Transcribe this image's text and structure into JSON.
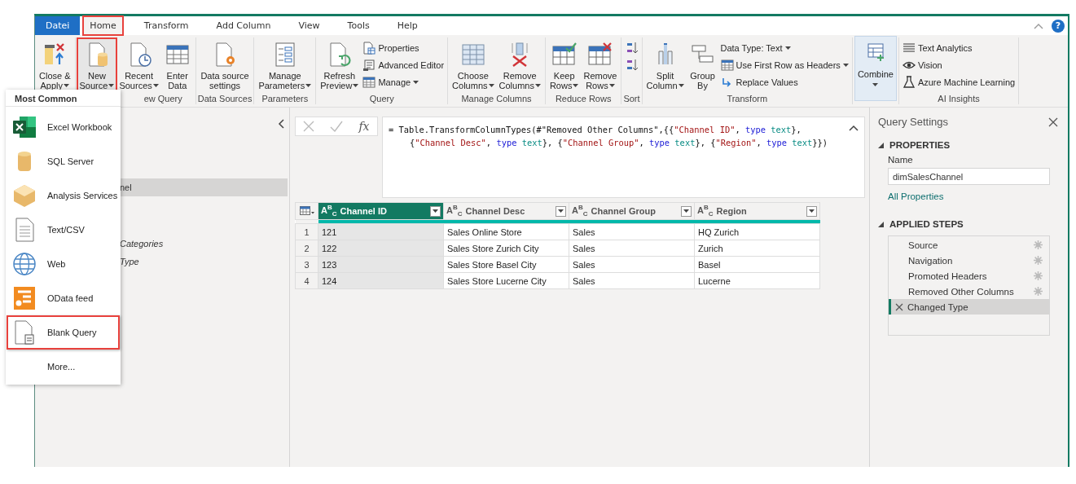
{
  "tabs": [
    {
      "label": "Datei",
      "kind": "file",
      "selected": false,
      "highlighted": false
    },
    {
      "label": "Home",
      "kind": "tab",
      "selected": true,
      "highlighted": true
    },
    {
      "label": "Transform",
      "kind": "tab",
      "selected": false,
      "highlighted": false
    },
    {
      "label": "Add Column",
      "kind": "tab",
      "selected": false,
      "highlighted": false
    },
    {
      "label": "View",
      "kind": "tab",
      "selected": false,
      "highlighted": false
    },
    {
      "label": "Tools",
      "kind": "tab",
      "selected": false,
      "highlighted": false
    },
    {
      "label": "Help",
      "kind": "tab",
      "selected": false,
      "highlighted": false
    }
  ],
  "help_label": "?",
  "ribbon_groups": [
    {
      "items": [
        {
          "kind": "large",
          "lines": [
            "Close &",
            "Apply"
          ],
          "dropdown": true,
          "highlighted": false,
          "pressed": false
        }
      ]
    },
    {
      "label": "ew Query",
      "items": [
        {
          "kind": "large",
          "lines": [
            "New",
            "Source"
          ],
          "dropdown": true,
          "highlighted": true,
          "pressed": false
        },
        {
          "kind": "large",
          "lines": [
            "Recent",
            "Sources"
          ],
          "dropdown": true,
          "highlighted": false,
          "pressed": false
        },
        {
          "kind": "large",
          "lines": [
            "Enter",
            "Data"
          ],
          "dropdown": false,
          "highlighted": false,
          "pressed": false
        }
      ]
    },
    {
      "label": "Data Sources",
      "items": [
        {
          "kind": "large",
          "lines": [
            "Data source",
            "settings"
          ],
          "dropdown": false,
          "highlighted": false,
          "pressed": false
        }
      ]
    },
    {
      "label": "Parameters",
      "items": [
        {
          "kind": "large",
          "lines": [
            "Manage",
            "Parameters"
          ],
          "dropdown": true,
          "highlighted": false,
          "pressed": false
        }
      ]
    },
    {
      "label": "Query",
      "items": [
        {
          "kind": "large",
          "lines": [
            "Refresh",
            "Preview"
          ],
          "dropdown": true,
          "highlighted": false,
          "pressed": false
        },
        {
          "kind": "stack",
          "items": [
            {
              "label": "Properties",
              "dropdown": false
            },
            {
              "label": "Advanced Editor",
              "dropdown": false
            },
            {
              "label": "Manage",
              "dropdown": true
            }
          ]
        }
      ]
    },
    {
      "label": "Manage Columns",
      "items": [
        {
          "kind": "large",
          "lines": [
            "Choose",
            "Columns"
          ],
          "dropdown": true,
          "highlighted": false,
          "pressed": false
        },
        {
          "kind": "large",
          "lines": [
            "Remove",
            "Columns"
          ],
          "dropdown": true,
          "highlighted": false,
          "pressed": false
        }
      ]
    },
    {
      "label": "Reduce Rows",
      "items": [
        {
          "kind": "large",
          "lines": [
            "Keep",
            "Rows"
          ],
          "dropdown": true,
          "highlighted": false,
          "pressed": false
        },
        {
          "kind": "large",
          "lines": [
            "Remove",
            "Rows"
          ],
          "dropdown": true,
          "highlighted": false,
          "pressed": false
        }
      ]
    },
    {
      "label": "Sort",
      "items": [
        {
          "kind": "stack",
          "items": [
            {
              "dropdown": false
            },
            {
              "dropdown": false
            }
          ]
        }
      ]
    },
    {
      "label": "Transform",
      "items": [
        {
          "kind": "large",
          "lines": [
            "Split",
            "Column"
          ],
          "dropdown": true,
          "highlighted": false,
          "pressed": false
        },
        {
          "kind": "large",
          "lines": [
            "Group",
            "By"
          ],
          "dropdown": false,
          "highlighted": false,
          "pressed": false
        },
        {
          "kind": "stack",
          "items": [
            {
              "label": "Data Type: Text",
              "dropdown": true
            },
            {
              "label": "Use First Row as Headers",
              "dropdown": true
            },
            {
              "label": "Replace Values",
              "dropdown": false
            }
          ]
        }
      ]
    },
    {
      "items": [
        {
          "kind": "large",
          "lines": [
            "Combine"
          ],
          "dropdown": true,
          "highlighted": false,
          "pressed": true
        }
      ]
    },
    {
      "label": "AI Insights",
      "items": [
        {
          "kind": "stack",
          "items": [
            {
              "label": "Text Analytics",
              "dropdown": false
            },
            {
              "label": "Vision",
              "dropdown": false
            },
            {
              "label": "Azure Machine Learning",
              "dropdown": false
            }
          ]
        }
      ]
    }
  ],
  "queries_pane": {
    "items": [
      {
        "label": "nel",
        "selected": true,
        "italic": false
      },
      {
        "label": "Categories",
        "selected": false,
        "italic": true
      },
      {
        "label": "Type",
        "selected": false,
        "italic": true
      }
    ]
  },
  "formula_bar": {
    "fx_label": "fx",
    "lines": [
      [
        {
          "text": "= Table.TransformColumnTypes(#\"Removed Other Columns\",{{",
          "kind": "plain"
        },
        {
          "text": "\"Channel ID\"",
          "kind": "string"
        },
        {
          "text": ", ",
          "kind": "plain"
        },
        {
          "text": "type",
          "kind": "keyword"
        },
        {
          "text": " text",
          "kind": "type"
        },
        {
          "text": "},",
          "kind": "plain"
        }
      ],
      [
        {
          "text": "{",
          "kind": "plain"
        },
        {
          "text": "\"Channel Desc\"",
          "kind": "string"
        },
        {
          "text": ", ",
          "kind": "plain"
        },
        {
          "text": "type",
          "kind": "keyword"
        },
        {
          "text": " text",
          "kind": "type"
        },
        {
          "text": "}, {",
          "kind": "plain"
        },
        {
          "text": "\"Channel Group\"",
          "kind": "string"
        },
        {
          "text": ", ",
          "kind": "plain"
        },
        {
          "text": "type",
          "kind": "keyword"
        },
        {
          "text": " text",
          "kind": "type"
        },
        {
          "text": "}, {",
          "kind": "plain"
        },
        {
          "text": "\"Region\"",
          "kind": "string"
        },
        {
          "text": ", ",
          "kind": "plain"
        },
        {
          "text": "type",
          "kind": "keyword"
        },
        {
          "text": " text",
          "kind": "type"
        },
        {
          "text": "}})",
          "kind": "plain"
        }
      ]
    ]
  },
  "table": {
    "columns": [
      {
        "name": "Channel ID",
        "type": "A$^{B}$$_{C}$",
        "selected": true
      },
      {
        "name": "Channel Desc",
        "type": "A$^{B}$$_{C}$",
        "selected": false
      },
      {
        "name": "Channel Group",
        "type": "A$^{B}$$_{C}$",
        "selected": false
      },
      {
        "name": "Region",
        "type": "A$^{B}$$_{C}$",
        "selected": false
      }
    ],
    "rows": [
      {
        "number": "1",
        "cells": [
          "121",
          "Sales Online Store",
          "Sales",
          "HQ Zurich"
        ]
      },
      {
        "number": "2",
        "cells": [
          "122",
          "Sales Store Zurich City",
          "Sales",
          "Zurich"
        ]
      },
      {
        "number": "3",
        "cells": [
          "123",
          "Sales Store Basel City",
          "Sales",
          "Basel"
        ]
      },
      {
        "number": "4",
        "cells": [
          "124",
          "Sales Store Lucerne City",
          "Sales",
          "Lucerne"
        ]
      }
    ]
  },
  "query_settings": {
    "title": "Query Settings",
    "properties_heading": "PROPERTIES",
    "name_label": "Name",
    "name_value": "dimSalesChannel",
    "all_properties_link": "All Properties",
    "steps_heading": "APPLIED STEPS",
    "steps": [
      {
        "label": "Source",
        "selected": false,
        "settings": true
      },
      {
        "label": "Navigation",
        "selected": false,
        "settings": true
      },
      {
        "label": "Promoted Headers",
        "selected": false,
        "settings": true
      },
      {
        "label": "Removed Other Columns",
        "selected": false,
        "settings": true
      },
      {
        "label": "Changed Type",
        "selected": true,
        "settings": false
      }
    ]
  },
  "new_source_menu": {
    "heading": "Most Common",
    "items": [
      {
        "label": "Excel Workbook",
        "highlighted": false
      },
      {
        "label": "SQL Server",
        "highlighted": false
      },
      {
        "label": "Analysis Services",
        "highlighted": false
      },
      {
        "label": "Text/CSV",
        "highlighted": false
      },
      {
        "label": "Web",
        "highlighted": false
      },
      {
        "label": "OData feed",
        "highlighted": false
      },
      {
        "label": "Blank Query",
        "highlighted": true
      },
      {
        "label": "More...",
        "highlighted": false
      }
    ]
  }
}
